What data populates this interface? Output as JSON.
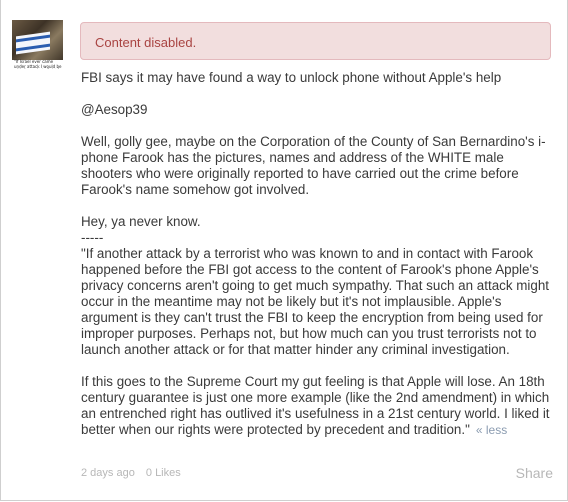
{
  "avatar": {
    "caption": "\"If Israel ever came under attack I would be with it, ready to fight for it\""
  },
  "alert": {
    "text": "Content disabled."
  },
  "post": {
    "title": "FBI says it may have found a way to unlock phone without Apple's help",
    "mention": "@Aesop39",
    "p1": "Well, golly gee, maybe on the Corporation of the County of San Bernardino's i-phone Farook has the pictures, names and address of the WHITE male shooters who were originally reported to have carried out the crime before Farook's name somehow got involved.",
    "p2a": "Hey, ya never know.",
    "p2b": "-----",
    "p2c": "\"If another attack by a terrorist who was known to and in contact with Farook happened before the FBI got access to the content of Farook's phone Apple's privacy concerns aren't going to get much sympathy. That such an attack might occur in the meantime may not be likely but it's not implausible. Apple's argument is they can't trust the FBI to keep the encryption from being used for improper purposes. Perhaps not, but how much can you trust terrorists not to launch another attack or for that matter hinder any criminal investigation.",
    "p3": "If this goes to the Supreme Court my gut feeling is that Apple will lose. An 18th century guarantee is just one more example (like the 2nd amendment) in which an entrenched right has outlived it's usefulness in a 21st century world. I liked it better when our rights were protected by precedent and tradition.\"",
    "less_label": "« less"
  },
  "footer": {
    "timestamp": "2 days ago",
    "likes": "0 Likes",
    "share_label": "Share"
  }
}
